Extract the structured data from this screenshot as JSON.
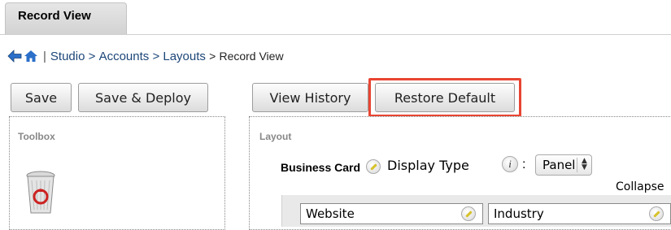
{
  "tab": {
    "label": "Record View"
  },
  "breadcrumb": {
    "studio": "Studio",
    "gt1": ">",
    "accounts": "Accounts",
    "gt2": ">",
    "layouts": "Layouts",
    "gt3": ">",
    "current": "Record View",
    "sep": "|"
  },
  "toolbar": {
    "save": "Save",
    "save_deploy": "Save & Deploy",
    "view_history": "View History",
    "restore_default": "Restore Default"
  },
  "toolbox": {
    "title": "Toolbox"
  },
  "layout": {
    "title": "Layout",
    "panel_name": "Business Card",
    "display_type_label": "Display Type",
    "colon": ":",
    "display_type_value": "Panel",
    "collapse_label": "Collapse",
    "fields": [
      "Website",
      "Industry"
    ]
  },
  "colors": {
    "highlight": "#e84532",
    "link": "#1c4678"
  }
}
